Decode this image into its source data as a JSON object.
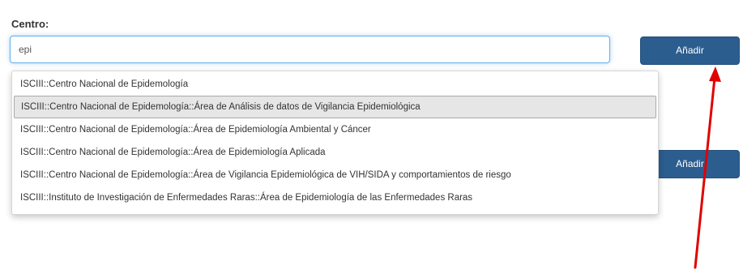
{
  "form": {
    "centro_label": "Centro:",
    "input_value": "epi",
    "add_label": "Añadir",
    "add_label_2": "Añadir"
  },
  "dropdown": {
    "items": [
      "ISCIII::Centro Nacional de Epidemología",
      "ISCIII::Centro Nacional de Epidemología::Área de Análisis de datos de Vigilancia Epidemiológica",
      "ISCIII::Centro Nacional de Epidemología::Área de Epidemiología Ambiental y Cáncer",
      "ISCIII::Centro Nacional de Epidemología::Área de Epidemiología Aplicada",
      "ISCIII::Centro Nacional de Epidemología::Área de Vigilancia Epidemiológica de VIH/SIDA y comportamientos de riesgo",
      "ISCIII::Instituto de Investigación de Enfermedades Raras::Área de Epidemiología de las Enfermedades Raras"
    ],
    "highlighted_index": 1
  },
  "colors": {
    "button_bg": "#2c5d8f",
    "annotation_arrow": "#e00000"
  },
  "annotation": {
    "icon": "red-arrow-icon"
  }
}
